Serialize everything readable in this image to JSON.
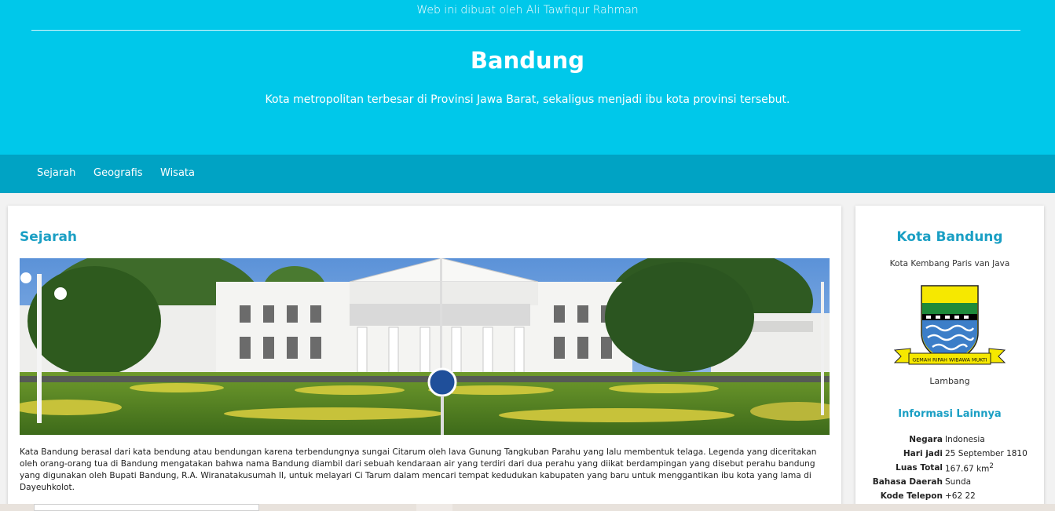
{
  "header": {
    "credit": "Web ini dibuat oleh Ali Tawfiqur Rahman",
    "title": "Bandung",
    "subtitle": "Kota metropolitan terbesar di Provinsi Jawa Barat, sekaligus menjadi ibu kota provinsi tersebut."
  },
  "nav": {
    "items": [
      {
        "label": "Sejarah"
      },
      {
        "label": "Geografis"
      },
      {
        "label": "Wisata"
      }
    ]
  },
  "main": {
    "section_title": "Sejarah",
    "image_subject": "gedung-sate-photo",
    "paragraph": "Kata Bandung berasal dari kata bendung atau bendungan karena terbendungnya sungai Citarum oleh lava Gunung Tangkuban Parahu yang lalu membentuk telaga. Legenda yang diceritakan oleh orang-orang tua di Bandung mengatakan bahwa nama Bandung diambil dari sebuah kendaraan air yang terdiri dari dua perahu yang diikat berdampingan yang disebut perahu bandung yang digunakan oleh Bupati Bandung, R.A. Wiranatakusumah II, untuk melayari Ci Tarum dalam mencari tempat kedudukan kabupaten yang baru untuk menggantikan ibu kota yang lama di Dayeuhkolot."
  },
  "sidebar": {
    "title": "Kota Bandung",
    "tagline": "Kota Kembang Paris van Java",
    "emblem_motto": "GEMAH RIPAH WIBAWA MUKTI",
    "emblem_caption": "Lambang",
    "info_title": "Informasi Lainnya",
    "info": [
      {
        "key": "Negara",
        "value": "Indonesia"
      },
      {
        "key": "Hari jadi",
        "value": "25 September 1810"
      },
      {
        "key": "Luas Total",
        "value": "167.67 km",
        "sup": "2"
      },
      {
        "key": "Bahasa Daerah",
        "value": "Sunda"
      },
      {
        "key": "Kode Telepon",
        "value": "+62 22"
      }
    ]
  },
  "colors": {
    "header_bg": "#00c8ea",
    "nav_bg": "#00a3c4",
    "accent": "#1a9fc4"
  }
}
